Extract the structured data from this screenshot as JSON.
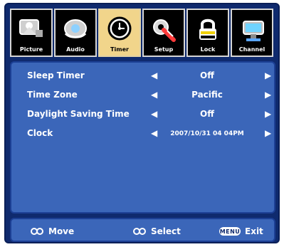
{
  "tabs": [
    {
      "label": "Picture",
      "icon": "tv-person-icon",
      "active": false
    },
    {
      "label": "Audio",
      "icon": "speaker-icon",
      "active": false
    },
    {
      "label": "Timer",
      "icon": "clock-icon",
      "active": true
    },
    {
      "label": "Setup",
      "icon": "gear-icon",
      "active": false
    },
    {
      "label": "Lock",
      "icon": "lock-icon",
      "active": false
    },
    {
      "label": "Channel",
      "icon": "tv-set-icon",
      "active": false
    }
  ],
  "menu": {
    "items": [
      {
        "label": "Sleep Timer",
        "value": "Off"
      },
      {
        "label": "Time Zone",
        "value": "Pacific"
      },
      {
        "label": "Daylight Saving Time",
        "value": "Off"
      },
      {
        "label": "Clock",
        "value": "2007/10/31 04 04PM"
      }
    ]
  },
  "footer": {
    "move_label": "Move",
    "select_label": "Select",
    "exit_label": "Exit",
    "menu_key_label": "MENU"
  },
  "colors": {
    "frame_bg": "#0f2a6e",
    "panel_bg": "#3b66b9",
    "active_tab": "#f1d58b"
  }
}
